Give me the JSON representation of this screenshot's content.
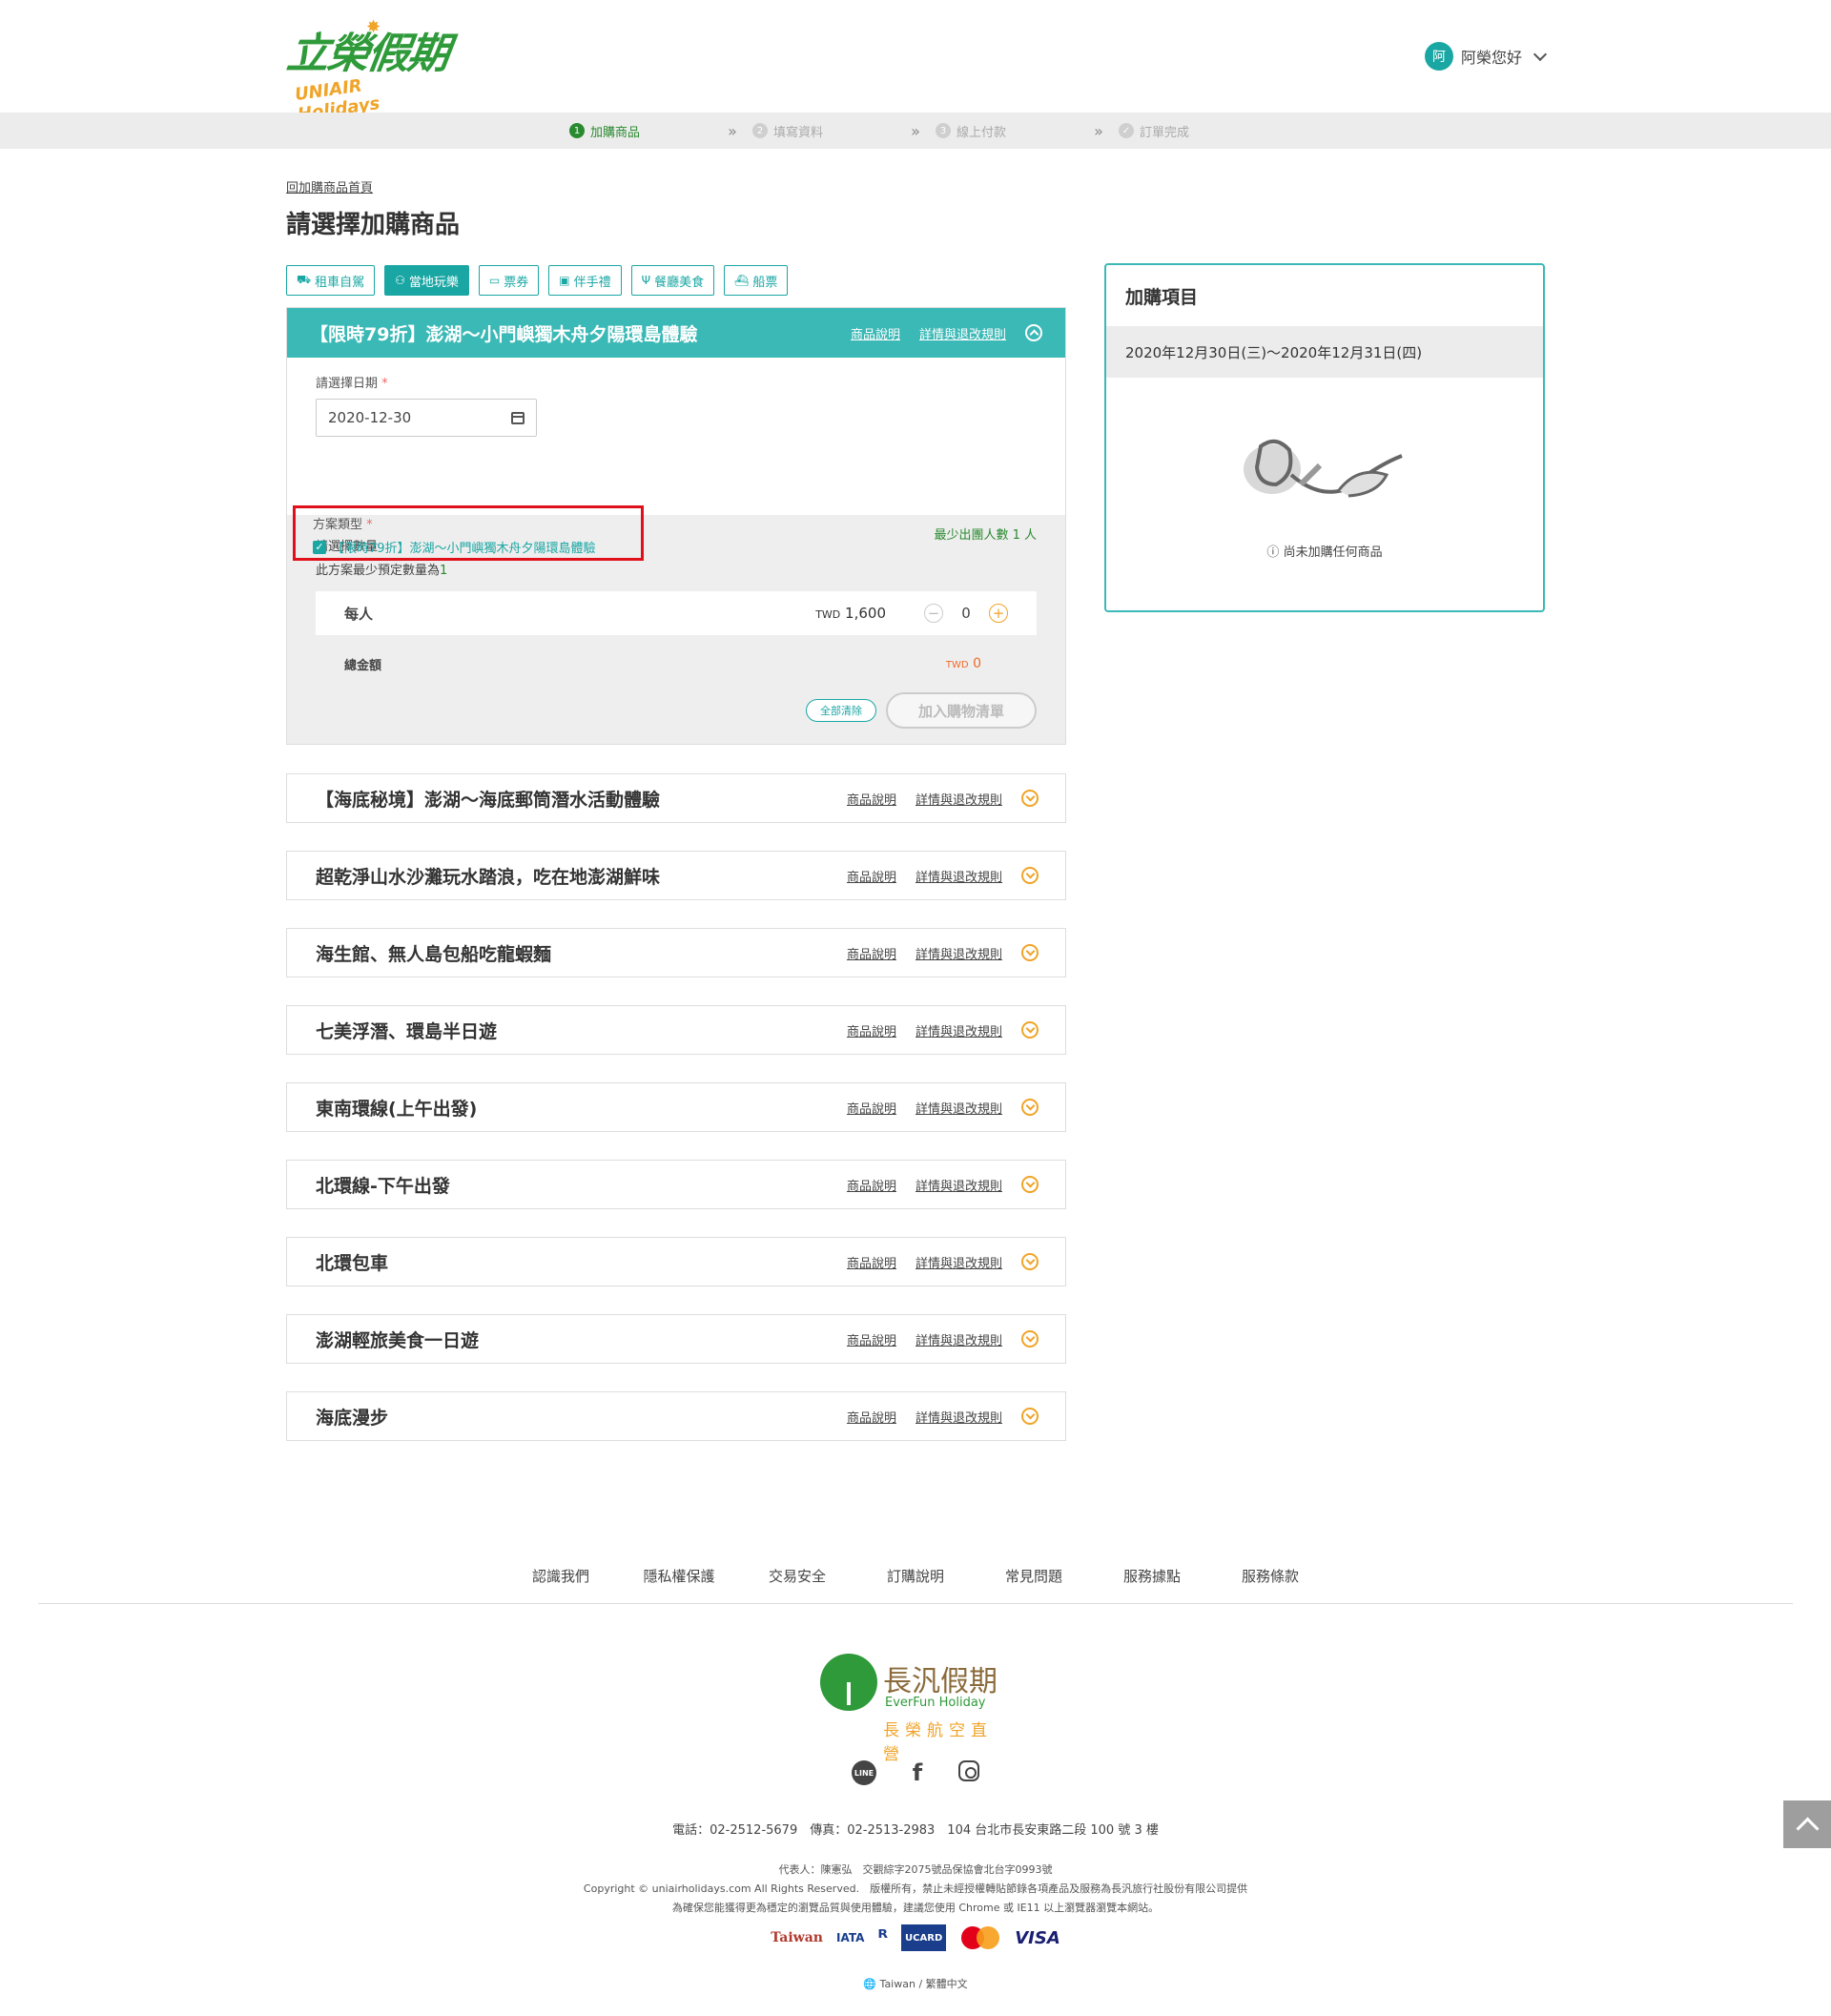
{
  "header": {
    "logo_main": "立榮假期",
    "logo_sub": "UNIAIR Holidays",
    "user_avatar": "阿",
    "user_greeting": "阿榮您好"
  },
  "steps": [
    {
      "num": "1",
      "label": "加購商品"
    },
    {
      "num": "2",
      "label": "填寫資料"
    },
    {
      "num": "3",
      "label": "線上付款"
    },
    {
      "num": "✓",
      "label": "訂單完成"
    }
  ],
  "main": {
    "back_link": "回加購商品首頁",
    "title": "請選擇加購商品",
    "categories": [
      {
        "icon": "car-icon",
        "glyph": "⛟",
        "label": "租車自駕"
      },
      {
        "icon": "person-icon",
        "glyph": "⚇",
        "label": "當地玩樂"
      },
      {
        "icon": "ticket-icon",
        "glyph": "▭",
        "label": "票券"
      },
      {
        "icon": "gift-icon",
        "glyph": "▣",
        "label": "伴手禮"
      },
      {
        "icon": "fork-icon",
        "glyph": "Ψ",
        "label": "餐廳美食"
      },
      {
        "icon": "ship-icon",
        "glyph": "⛴",
        "label": "船票"
      }
    ]
  },
  "panel": {
    "title": "【限時79折】澎湖～小門嶼獨木舟夕陽環島體驗",
    "link_desc": "商品說明",
    "link_rules": "詳情與退改規則",
    "date_label": "請選擇日期",
    "required_mark": "*",
    "date_value": "2020-12-30",
    "plan_label": "方案類型",
    "plan_option": "【限時79折】澎湖～小門嶼獨木舟夕陽環島體驗",
    "min_people": "最少出團人數 1 人",
    "qty_label": "請選擇數量",
    "qty_min_text": "此方案最少預定數量為",
    "qty_min_value": "1",
    "per_person": "每人",
    "currency": "TWD",
    "price": "1,600",
    "quantity": "0",
    "total_label": "總金額",
    "total_value": "0",
    "clear_all": "全部清除",
    "add_to_cart": "加入購物清單"
  },
  "items": [
    {
      "title": "【海底秘境】澎湖～海底郵筒潛水活動體驗"
    },
    {
      "title": "超乾淨山水沙灘玩水踏浪，吃在地澎湖鮮味"
    },
    {
      "title": "海生館、無人島包船吃龍蝦麵"
    },
    {
      "title": "七美浮潛、環島半日遊"
    },
    {
      "title": "東南環線(上午出發)"
    },
    {
      "title": "北環線-下午出發"
    },
    {
      "title": "北環包車"
    },
    {
      "title": "澎湖輕旅美食一日遊"
    },
    {
      "title": "海底漫步"
    }
  ],
  "item_links": {
    "desc": "商品說明",
    "rules": "詳情與退改規則"
  },
  "side": {
    "title": "加購項目",
    "date_range": "2020年12月30日(三)～2020年12月31日(四)",
    "empty_msg": "尚未加購任何商品"
  },
  "footer": {
    "nav": [
      "認識我們",
      "隱私權保護",
      "交易安全",
      "訂購說明",
      "常見問題",
      "服務據點",
      "服務條款"
    ],
    "logo_main": "長汎假期",
    "logo_en": "EverFun Holiday",
    "logo_sub": "長榮航空直營",
    "contact": "電話：02-2512-5679　傳真：02-2513-2983　104 台北市長安東路二段 100 號 3 樓",
    "rep": "代表人：陳憲弘　交觀綜字2075號品保協會北台字0993號",
    "copyright": "Copyright © uniairholidays.com All Rights Reserved.　版權所有，禁止未經授權轉貼節錄各項產品及服務為長汎旅行社股份有限公司提供",
    "browser": "為確保您能獲得更為穩定的瀏覽品質與使用體驗，建議您使用 Chrome 或 IE11 以上瀏覽器瀏覽本網站。",
    "pay_taiwan": "Taiwan",
    "pay_iata": "IATA",
    "pay_ucard": "UCARD",
    "pay_mc": "mastercard",
    "pay_visa": "VISA",
    "line": "LINE",
    "language": "Taiwan / 繁體中文"
  },
  "colors": {
    "teal": "#3bb9b6",
    "green": "#2a8a2f",
    "orange": "#f0a428",
    "highlight": "#e0101a"
  }
}
